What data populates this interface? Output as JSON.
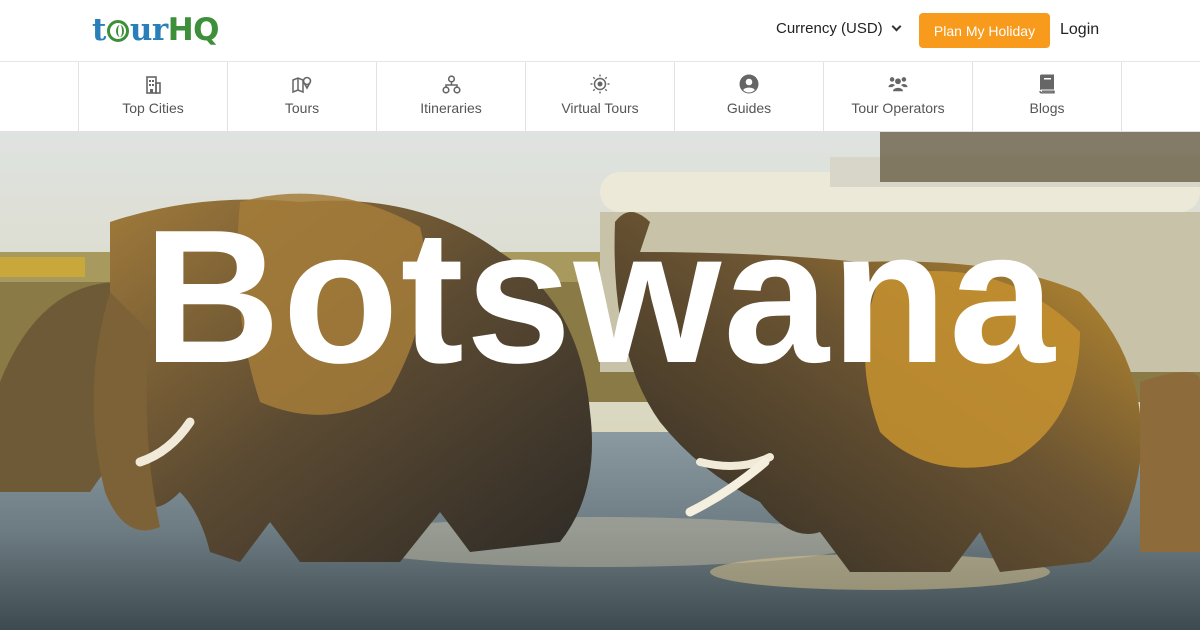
{
  "header": {
    "logo": {
      "part1": "t",
      "part2": "ur",
      "part3": "HQ"
    },
    "currency_label": "Currency (USD)",
    "plan_button": "Plan My Holiday",
    "login": "Login",
    "accent_color": "#f89a1c"
  },
  "nav": {
    "items": [
      {
        "label": "Top Cities",
        "icon": "building-icon"
      },
      {
        "label": "Tours",
        "icon": "map-pin-icon"
      },
      {
        "label": "Itineraries",
        "icon": "network-icon"
      },
      {
        "label": "Virtual Tours",
        "icon": "target-icon"
      },
      {
        "label": "Guides",
        "icon": "user-circle-icon"
      },
      {
        "label": "Tour Operators",
        "icon": "users-icon"
      },
      {
        "label": "Blogs",
        "icon": "book-icon"
      }
    ]
  },
  "hero": {
    "title": "Botswana",
    "image": "elephants-in-river-icon"
  }
}
